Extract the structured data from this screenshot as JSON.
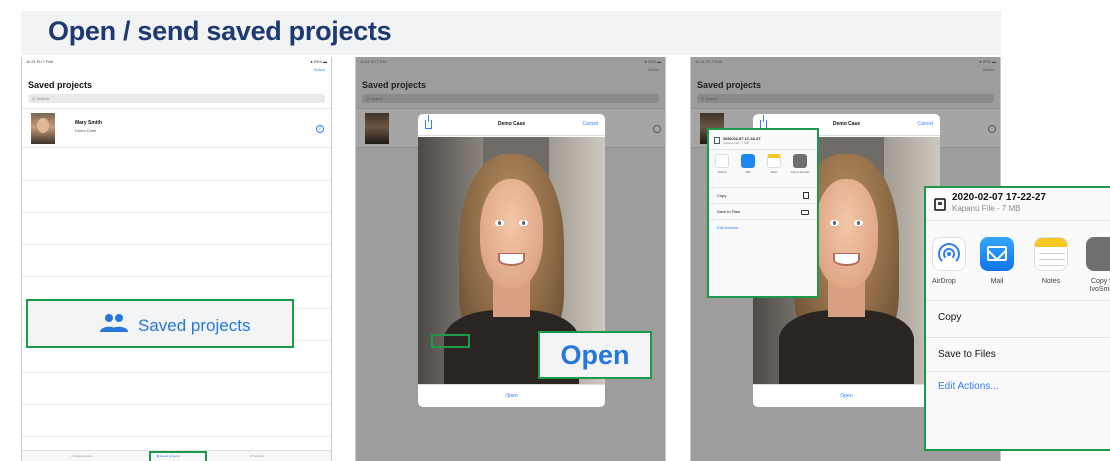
{
  "header": {
    "title": "Open / send saved projects"
  },
  "ipad": {
    "status_time": "11:21 Fri 7 Feb",
    "battery": "● 93% ▬",
    "select_label": "Select",
    "list_title": "Saved projects",
    "search_placeholder": "Q Search",
    "project": {
      "name": "Mary Smith",
      "subtitle": "Demo Case"
    },
    "tabs": [
      "⌂ Measurements",
      "▮ Saved projects",
      "⚙ Settings"
    ]
  },
  "callouts": {
    "saved_projects": "Saved projects",
    "open": "Open"
  },
  "preview_modal": {
    "title": "Demo Case",
    "cancel": "Cancel",
    "open": "Open"
  },
  "share_sheet": {
    "file_name": "2020-02-07 17-22-27",
    "file_sub": "Kapanu File - 7 MB",
    "apps": [
      "AirDrop",
      "Mail",
      "Notes",
      "Copy to IvoSmile"
    ],
    "copy": "Copy",
    "save_to_files": "Save to Files",
    "edit_actions": "Edit Actions..."
  },
  "colors": {
    "title": "#1f3a72",
    "accent_blue": "#2677d9",
    "ios_blue": "#2f7df6",
    "highlight_green": "#1a9a4a"
  }
}
